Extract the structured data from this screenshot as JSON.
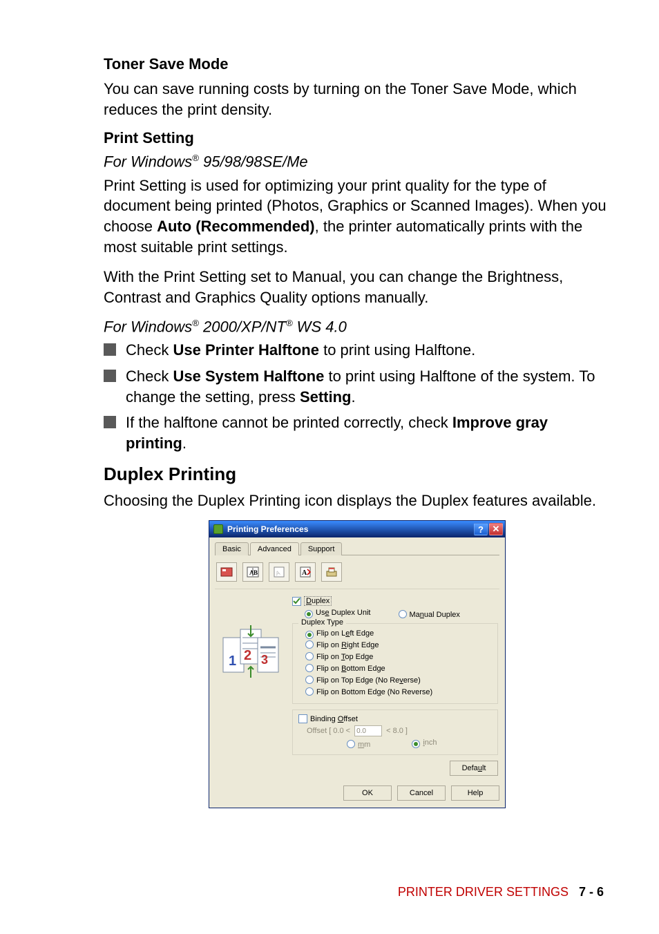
{
  "sections": {
    "toner_h": "Toner Save Mode",
    "toner_p": "You can save running costs by turning on the Toner Save Mode, which reduces the print density.",
    "print_h": "Print Setting",
    "win1_pre": "For Windows",
    "reg": "®",
    "win1_post": " 95/98/98SE/Me",
    "print_p1a": "Print Setting is used for optimizing your print quality for the type of document being printed (Photos, Graphics or Scanned Images). When you choose ",
    "print_p1_bold": "Auto (Recommended)",
    "print_p1b": ", the printer automatically prints with the most suitable print settings.",
    "print_p2": "With the Print Setting set to Manual, you can change the Brightness, Contrast and Graphics Quality options manually.",
    "win2_pre": "For Windows",
    "win2_mid": " 2000/XP/NT",
    "win2_post": " WS 4.0",
    "b1_a": "Check ",
    "b1_bold": "Use Printer Halftone",
    "b1_b": " to print using Halftone.",
    "b2_a": "Check ",
    "b2_bold": "Use System Halftone",
    "b2_b": " to print using Halftone of the system. To change the setting, press ",
    "b2_bold2": "Setting",
    "b2_c": ".",
    "b3_a": "If the halftone cannot be printed correctly, check ",
    "b3_bold": "Improve gray printing",
    "b3_b": ".",
    "duplex_h": "Duplex Printing",
    "duplex_p": "Choosing the Duplex Printing icon displays the Duplex features available."
  },
  "dialog": {
    "title": "Printing Preferences",
    "tabs": {
      "t1": "Basic",
      "t2": "Advanced",
      "t3": "Support"
    },
    "duplex_chk": "Duplex",
    "use_unit": "Use Duplex Unit",
    "manual": "Manual Duplex",
    "duplex_type": "Duplex Type",
    "opts": {
      "o1": "Flip on Left Edge",
      "o2": "Flip on Right Edge",
      "o3": "Flip on Top Edge",
      "o4": "Flip on Bottom Edge",
      "o5": "Flip on Top Edge (No Reverse)",
      "o6": "Flip on Bottom Edge (No Reverse)"
    },
    "binding": "Binding Offset",
    "offset_pre": "Offset   [    0.0  <",
    "offset_val": "0.0",
    "offset_post": "<   8.0       ]",
    "mm": "mm",
    "inch": "inch",
    "default": "Default",
    "ok": "OK",
    "cancel": "Cancel",
    "help": "Help"
  },
  "footer": {
    "label": "PRINTER DRIVER SETTINGS",
    "page": "7 - 6"
  }
}
